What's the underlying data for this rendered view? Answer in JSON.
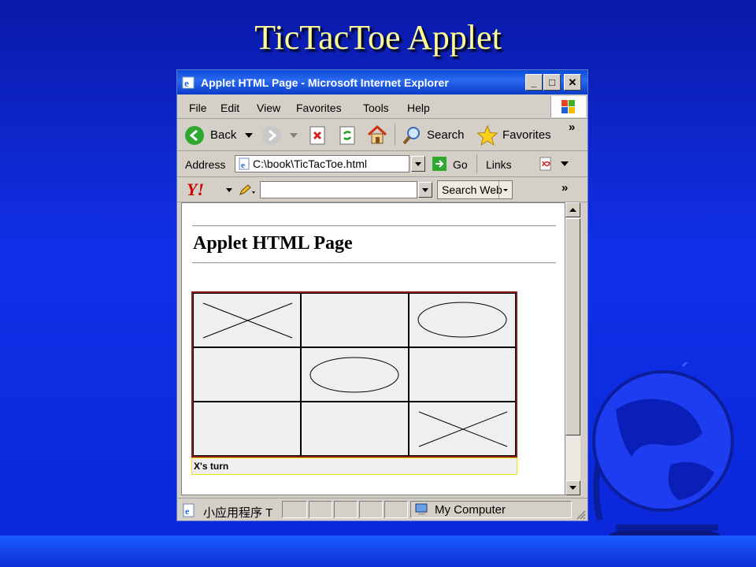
{
  "slide": {
    "title": "TicTacToe Applet"
  },
  "window": {
    "title": "Applet HTML Page - Microsoft Internet Explorer",
    "controls": [
      "_",
      "□",
      "✕"
    ]
  },
  "menu": [
    "File",
    "Edit",
    "View",
    "Favorites",
    "Tools",
    "Help"
  ],
  "toolbar": {
    "back_label": "Back",
    "search_label": "Search",
    "favorites_label": "Favorites",
    "overflow": "»"
  },
  "address": {
    "label": "Address",
    "value": "C:\\book\\TicTacToe.html",
    "go_label": "Go",
    "links_label": "Links"
  },
  "yahoo": {
    "logo": "Y!",
    "search_value": "",
    "search_button": "Search Web",
    "overflow": "»"
  },
  "page": {
    "heading": "Applet HTML Page",
    "board": [
      [
        "X",
        "",
        "O"
      ],
      [
        "",
        "O",
        ""
      ],
      [
        "",
        "",
        "X"
      ]
    ],
    "status": "X's turn"
  },
  "statusbar": {
    "left_text": "小应用程序 T",
    "zone_text": "My Computer"
  },
  "colors": {
    "slide_background": "#0a26d8",
    "title_color": "#ffff99",
    "titlebar_blue": "#0a4ad8",
    "board_border": "#8b1a1a",
    "status_border": "#e8e800"
  }
}
